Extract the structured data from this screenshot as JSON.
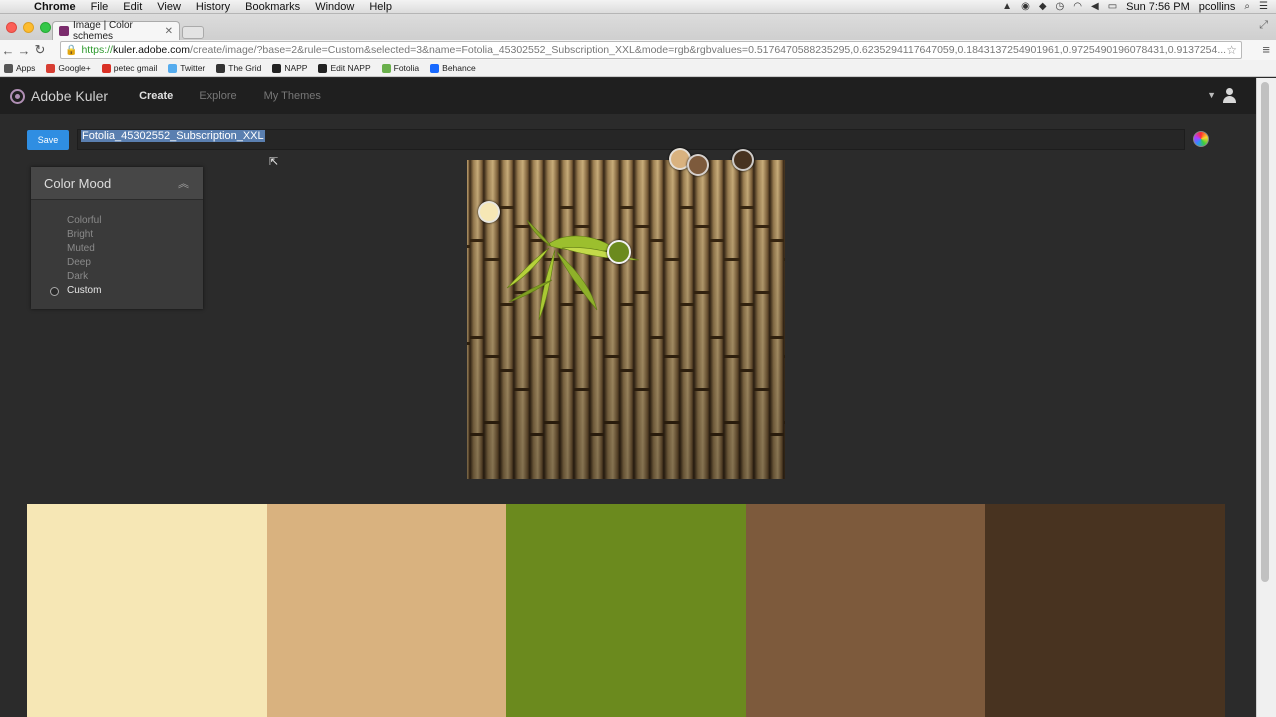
{
  "menubar": {
    "app": "Chrome",
    "items": [
      "File",
      "Edit",
      "View",
      "History",
      "Bookmarks",
      "Window",
      "Help"
    ],
    "clock": "Sun 7:56 PM",
    "user": "pcollins"
  },
  "browser": {
    "tab_title": "Image | Color schemes",
    "url_scheme": "https://",
    "url_host": "kuler.adobe.com",
    "url_path": "/create/image/?base=2&rule=Custom&selected=3&name=Fotolia_45302552_Subscription_XXL&mode=rgb&rgbvalues=0.5176470588235295,0.6235294117647059,0.1843137254901961,0.9725490196078431,0.9137254...",
    "bookmarks": [
      {
        "label": "Apps",
        "icon": "apps-grid-icon",
        "color": "#555555"
      },
      {
        "label": "Google+",
        "icon": "google-plus-icon",
        "color": "#d73d32"
      },
      {
        "label": "petec gmail",
        "icon": "gmail-icon",
        "color": "#d93025"
      },
      {
        "label": "Twitter",
        "icon": "twitter-icon",
        "color": "#55acee"
      },
      {
        "label": "The Grid",
        "icon": "grid-icon",
        "color": "#333333"
      },
      {
        "label": "NAPP",
        "icon": "napp-icon",
        "color": "#222222"
      },
      {
        "label": "Edit NAPP",
        "icon": "napp-icon",
        "color": "#222222"
      },
      {
        "label": "Fotolia",
        "icon": "fotolia-icon",
        "color": "#6ab04c"
      },
      {
        "label": "Behance",
        "icon": "behance-icon",
        "color": "#1769ff"
      }
    ]
  },
  "kuler": {
    "brand": "Adobe Kuler",
    "nav": [
      "Create",
      "Explore",
      "My Themes"
    ],
    "save_label": "Save",
    "theme_name": "Fotolia_45302552_Subscription_XXL",
    "mood_title": "Color Mood",
    "moods": [
      "Colorful",
      "Bright",
      "Muted",
      "Deep",
      "Dark",
      "Custom"
    ],
    "selected_mood": "Custom",
    "swatches": [
      "#f6e7b5",
      "#d9b27f",
      "#6b8a1e",
      "#7d5a3c",
      "#483320"
    ]
  }
}
